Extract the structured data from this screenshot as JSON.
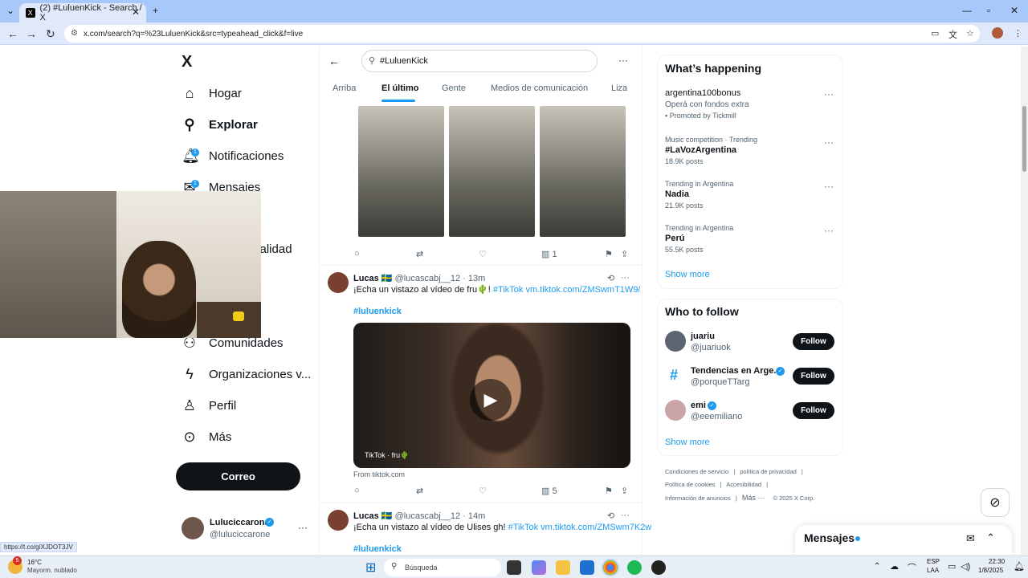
{
  "browser": {
    "tab_title": "(2) #LuluenKick - Search / X",
    "tab_favicon": "X",
    "url": "x.com/search?q=%23LuluenKick&src=typeahead_click&f=live",
    "status_url": "https://t.co/gIXJDOT3JV"
  },
  "nav": {
    "logo": "X",
    "items": [
      {
        "label": "Hogar",
        "icon": "home-icon"
      },
      {
        "label": "Explorar",
        "icon": "search-icon"
      },
      {
        "label": "Notificaciones",
        "icon": "bell-icon",
        "badge": "1"
      },
      {
        "label": "Mensajes",
        "icon": "mail-icon",
        "badge": "1"
      },
      {
        "label": "calidad",
        "icon": "grok-icon"
      },
      {
        "label": "s",
        "icon": "list-icon"
      },
      {
        "label": "Comunidades",
        "icon": "communities-icon"
      },
      {
        "label": "Organizaciones v...",
        "icon": "lightning-icon"
      },
      {
        "label": "Perfil",
        "icon": "person-icon"
      },
      {
        "label": "Más",
        "icon": "more-icon"
      }
    ],
    "post_button": "Correo",
    "account": {
      "name": "Luluciccarona",
      "handle": "@luluciccarone"
    }
  },
  "search": {
    "query": "#LuluenKick",
    "tabs": [
      "Arriba",
      "El último",
      "Gente",
      "Medios de comunicación",
      "Liza"
    ],
    "active_tab": "El último"
  },
  "tweets": [
    {
      "views": "1"
    },
    {
      "name": "Lucas 🇸🇪",
      "handle": "@lucascabj__12",
      "time": "· 13m",
      "text": "¡Echa un vistazo al vídeo de fru🌵!",
      "hashtag_inline": "#TikTok",
      "link": "vm.tiktok.com/ZMSwmT1W9/",
      "hashtag": "#luluenkick",
      "video_label": "TikTok · fru🌵",
      "source": "From tiktok.com",
      "views": "5"
    },
    {
      "name": "Lucas 🇸🇪",
      "handle": "@lucascabj__12",
      "time": "· 14m",
      "text": "¡Echa un vistazo al vídeo de Ulises gh!",
      "hashtag_inline": "#TikTok",
      "link": "vm.tiktok.com/ZMSwm7K2w",
      "hashtag": "#luluenkick"
    }
  ],
  "happening": {
    "title": "What’s happening",
    "trends": [
      {
        "context": "",
        "title": "argentina100bonus",
        "sub": "Operá con fondos extra",
        "meta": "Promoted by Tickmill"
      },
      {
        "context": "Music competition · Trending",
        "title": "#LaVozArgentina",
        "meta": "18.9K posts"
      },
      {
        "context": "Trending in Argentina",
        "title": "Nadia",
        "meta": "21.9K posts"
      },
      {
        "context": "Trending in Argentina",
        "title": "Perú",
        "meta": "55.5K posts"
      }
    ],
    "show_more": "Show more"
  },
  "who_to_follow": {
    "title": "Who to follow",
    "accounts": [
      {
        "name": "juariu",
        "handle": "@juariuok",
        "button": "Follow"
      },
      {
        "name": "Tendencias en Arge...",
        "handle": "@porqueTTarg",
        "button": "Follow"
      },
      {
        "name": "emi",
        "handle": "@eeemiliano",
        "button": "Follow"
      }
    ],
    "show_more": "Show more"
  },
  "footer": {
    "line1": [
      "Condiciones de servicio",
      "|",
      "política de privacidad",
      "|"
    ],
    "line2": [
      "Política de cookies",
      "|",
      "Accesibilidad",
      "|"
    ],
    "line3": [
      "Información de anuncios",
      "|",
      "Más ···",
      "© 2025 X Corp."
    ]
  },
  "messages_drawer": {
    "label": "Mensajes"
  },
  "taskbar": {
    "weather_temp": "16°C",
    "weather_desc": "Mayorm. nublado",
    "search_placeholder": "Búsqueda",
    "lang": "ESP",
    "lang2": "LAA",
    "time": "22:30",
    "date": "1/8/2025",
    "notif_count": "5"
  },
  "colors": {
    "accent": "#1d9bf0",
    "tabbar": "#a8c7fa",
    "text": "#0f1419"
  }
}
